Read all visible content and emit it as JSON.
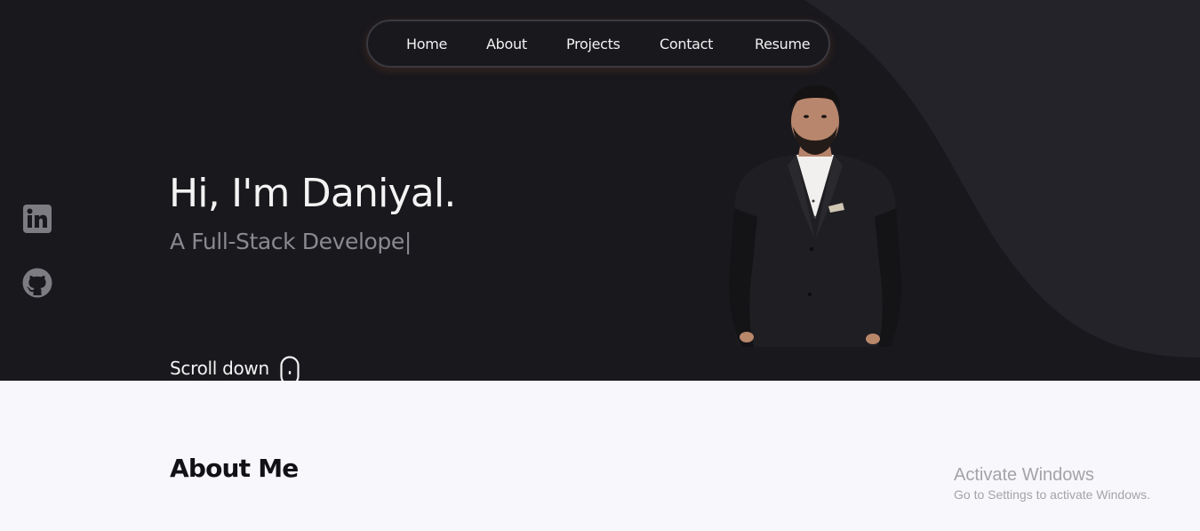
{
  "nav": {
    "items": [
      {
        "label": "Home"
      },
      {
        "label": "About"
      },
      {
        "label": "Projects"
      },
      {
        "label": "Contact"
      },
      {
        "label": "Resume"
      }
    ]
  },
  "social": [
    {
      "icon": "linkedin-icon"
    },
    {
      "icon": "github-icon"
    }
  ],
  "hero": {
    "title": "Hi, I'm Daniyal.",
    "subtitle": "A Full-Stack Develope|",
    "scroll_label": "Scroll down",
    "scroll_icon": "mouse-icon"
  },
  "about": {
    "title": "About Me"
  },
  "watermark": {
    "title": "Activate Windows",
    "subtitle": "Go to Settings to activate Windows."
  },
  "colors": {
    "hero_bg": "#19181d",
    "hero_curve": "#24232a",
    "about_bg": "#f8f7fc",
    "text_light": "#f3f3f3",
    "text_muted": "#8a8990"
  }
}
